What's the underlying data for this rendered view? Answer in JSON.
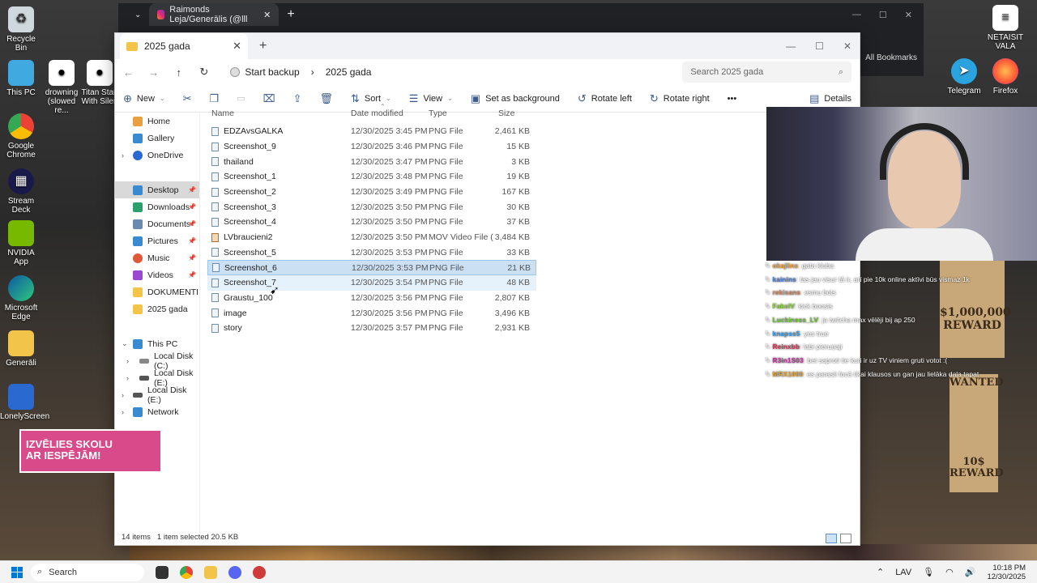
{
  "browser": {
    "tab_title": "Raimonds Leja/Generālis (@lll",
    "bookmarks": "All Bookmarks"
  },
  "desktop": {
    "icons_left": [
      "Recycle Bin",
      "This PC",
      "drowning (slowed re...",
      "Titan Stan With Silen",
      "Google Chrome",
      "Stream Deck",
      "NVIDIA App",
      "Microsoft Edge",
      "Generāli",
      "LonelyScreen"
    ],
    "icons_right": [
      "NETAISIT VALA",
      "Telegram",
      "Firefox"
    ]
  },
  "explorer": {
    "tab_title": "2025 gada",
    "breadcrumb": {
      "backup": "Start backup",
      "folder": "2025 gada"
    },
    "search_placeholder": "Search 2025 gada",
    "toolbar": {
      "new": "New",
      "sort": "Sort",
      "view": "View",
      "set_background": "Set as background",
      "rotate_left": "Rotate left",
      "rotate_right": "Rotate right",
      "more": "•••",
      "details": "Details"
    },
    "nav": [
      {
        "label": "Home"
      },
      {
        "label": "Gallery"
      },
      {
        "label": "OneDrive"
      },
      {
        "label": "Desktop"
      },
      {
        "label": "Downloads"
      },
      {
        "label": "Documents"
      },
      {
        "label": "Pictures"
      },
      {
        "label": "Music"
      },
      {
        "label": "Videos"
      },
      {
        "label": "DOKUMENTI"
      },
      {
        "label": "2025 gada"
      },
      {
        "label": "This PC"
      },
      {
        "label": "Local Disk (C:)"
      },
      {
        "label": "Local Disk (E:)"
      },
      {
        "label": "Local Disk (E:)"
      },
      {
        "label": "Network"
      }
    ],
    "columns": {
      "name": "Name",
      "date": "Date modified",
      "type": "Type",
      "size": "Size"
    },
    "files": [
      {
        "name": "EDZAvsGALKA",
        "date": "12/30/2025 3:45 PM",
        "type": "PNG File",
        "size": "2,461 KB"
      },
      {
        "name": "Screenshot_9",
        "date": "12/30/2025 3:46 PM",
        "type": "PNG File",
        "size": "15 KB"
      },
      {
        "name": "thailand",
        "date": "12/30/2025 3:47 PM",
        "type": "PNG File",
        "size": "3 KB"
      },
      {
        "name": "Screenshot_1",
        "date": "12/30/2025 3:48 PM",
        "type": "PNG File",
        "size": "19 KB"
      },
      {
        "name": "Screenshot_2",
        "date": "12/30/2025 3:49 PM",
        "type": "PNG File",
        "size": "167 KB"
      },
      {
        "name": "Screenshot_3",
        "date": "12/30/2025 3:50 PM",
        "type": "PNG File",
        "size": "30 KB"
      },
      {
        "name": "Screenshot_4",
        "date": "12/30/2025 3:50 PM",
        "type": "PNG File",
        "size": "37 KB"
      },
      {
        "name": "LVbraucieni2",
        "date": "12/30/2025 3:50 PM",
        "type": "MOV Video File (V...",
        "size": "3,484 KB"
      },
      {
        "name": "Screenshot_5",
        "date": "12/30/2025 3:53 PM",
        "type": "PNG File",
        "size": "33 KB"
      },
      {
        "name": "Screenshot_6",
        "date": "12/30/2025 3:53 PM",
        "type": "PNG File",
        "size": "21 KB"
      },
      {
        "name": "Screenshot_7",
        "date": "12/30/2025 3:54 PM",
        "type": "PNG File",
        "size": "48 KB"
      },
      {
        "name": "Graustu_100",
        "date": "12/30/2025 3:56 PM",
        "type": "PNG File",
        "size": "2,807 KB"
      },
      {
        "name": "image",
        "date": "12/30/2025 3:56 PM",
        "type": "PNG File",
        "size": "3,496 KB"
      },
      {
        "name": "story",
        "date": "12/30/2025 3:57 PM",
        "type": "PNG File",
        "size": "2,931 KB"
      }
    ],
    "selected_index": 9,
    "hover_index": 10,
    "status": {
      "items": "14 items",
      "selected": "1 item selected  20.5 KB"
    }
  },
  "chat": [
    {
      "user": "okajlins",
      "text": ": gata kluba",
      "color": "#f0a030"
    },
    {
      "user": "kainins",
      "text": ": tas jau visur tā ir, arī pie 10k online aktīvi būs vismaz 1k",
      "color": "#4f7fd8"
    },
    {
      "user": "rekisans",
      "text": ": esmu bots",
      "color": "#c88a6a"
    },
    {
      "user": "FakelV",
      "text": ": kick boosts",
      "color": "#8fd03a"
    },
    {
      "user": "Luckiness_LV",
      "text": ": ja twitcha max vēlēji bij ap 250",
      "color": "#6fc03a"
    },
    {
      "user": "knapss5",
      "text": ": yes true",
      "color": "#3a9ae0"
    },
    {
      "user": "Reinxbb",
      "text": ": labi pieruņaji",
      "color": "#d03a5a"
    },
    {
      "user": "R3in1S03",
      "text": ": bet saproti tie kuri ir uz TV viniem gruti votot :(",
      "color": "#c03aa0"
    },
    {
      "user": "MRX1000",
      "text": ": es parasti focā tikai klausos un gan jau lielāka daļa tapat",
      "color": "#e0a030"
    }
  ],
  "posters": {
    "reward1": "$1,000,000",
    "reward1_label": "REWARD",
    "wanted": "WANTED",
    "reward2": "10$",
    "reward2_label": "REWARD"
  },
  "promo": {
    "line1": "IZVĒLIES SKOLU",
    "line2": "AR IESPĒJĀM!"
  },
  "taskbar": {
    "search": "Search",
    "lang": "LAV",
    "time": "10:18 PM",
    "date": "12/30/2025"
  }
}
